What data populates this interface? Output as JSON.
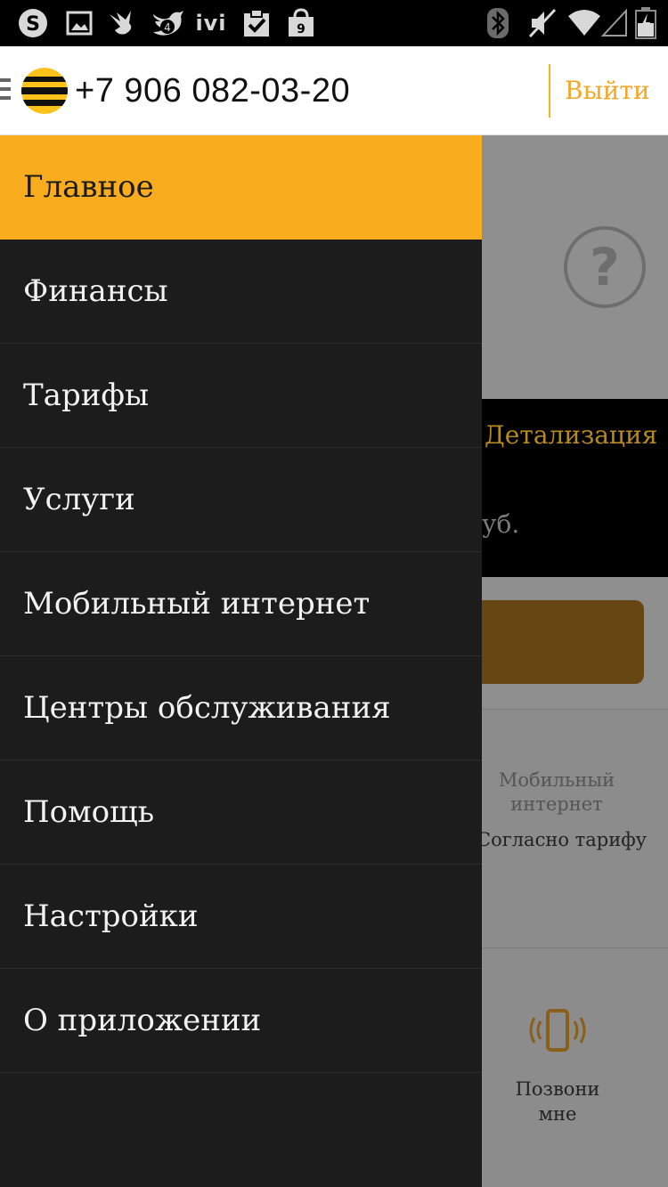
{
  "status_bar": {
    "icons": [
      "skype-icon",
      "gallery-icon",
      "bird-icon",
      "twitter-icon",
      "ivi-icon",
      "clipboard-check-icon",
      "shopping-bag-icon",
      "bluetooth-icon",
      "mute-icon",
      "wifi-icon",
      "signal-icon",
      "battery-icon"
    ],
    "twitter_count": "4",
    "bag_count": "9",
    "ivi_label": "ivi"
  },
  "header": {
    "phone": "+7 906 082-03-20",
    "logout_label": "Выйти"
  },
  "menu": {
    "items": [
      {
        "label": "Главное",
        "active": true
      },
      {
        "label": "Финансы"
      },
      {
        "label": "Тарифы"
      },
      {
        "label": "Услуги"
      },
      {
        "label": "Мобильный интернет"
      },
      {
        "label": "Центры обслуживания"
      },
      {
        "label": "Помощь"
      },
      {
        "label": "Настройки"
      },
      {
        "label": "О приложении"
      }
    ]
  },
  "background": {
    "help_symbol": "?",
    "detail_link": "Детализация",
    "balance_unit": "уб.",
    "mobile_internet_title": "Мобильный интернет",
    "mobile_internet_value": "Согласно тарифу",
    "call_me_label": "Позвони мне"
  },
  "colors": {
    "accent": "#f9ac1d",
    "drawer_bg": "#1c1c1c",
    "logout": "#f5a623"
  }
}
